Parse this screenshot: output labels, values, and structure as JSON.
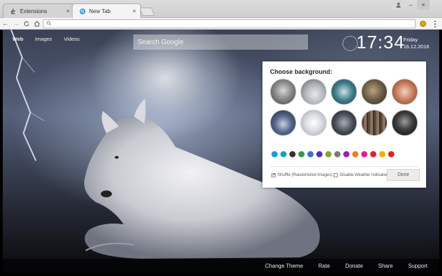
{
  "browser": {
    "tabs": [
      {
        "label": "Extensions",
        "icon": "puzzle-icon",
        "active": false
      },
      {
        "label": "New Tab",
        "icon": "new-tab-favicon",
        "active": true
      }
    ],
    "close_glyph": "×",
    "window_controls": {
      "user": "user-icon",
      "minimize": "–",
      "close": "×"
    },
    "nav": {
      "back": "←",
      "forward": "→",
      "reload": "C",
      "home": "⌂"
    },
    "omnibox": {
      "value": "",
      "icon": "search-icon"
    },
    "extension_icon": "extension-badge-icon",
    "menu_icon": "kebab-menu-icon"
  },
  "page": {
    "nav": [
      {
        "label": "Web",
        "active": true
      },
      {
        "label": "Images",
        "active": false
      },
      {
        "label": "Videos",
        "active": false
      }
    ],
    "search": {
      "placeholder": "Search Google"
    },
    "clock": {
      "time": "17:34",
      "day": "Friday",
      "date": "16.12.2016"
    }
  },
  "panel": {
    "title": "Choose background:",
    "thumbnails": [
      "wolf-face-gray",
      "wolf-lying-snow",
      "wolf-teal",
      "wolf-brown-forest",
      "wolf-red",
      "wolf-blue-night",
      "white-wolf-mist",
      "wolf-dark-moon",
      "forest-trees",
      "black-wolf"
    ],
    "colors": [
      "#1a9bd7",
      "#17a2b8",
      "#333333",
      "#2e9e44",
      "#3b6fd6",
      "#5a2db8",
      "#7bab2a",
      "#7a7a7a",
      "#9b1fb5",
      "#e8821e",
      "#e0218a",
      "#e02424",
      "#f0b400",
      "#d9261c"
    ],
    "options": [
      {
        "label": "Shuffle (Randomized Images)",
        "checked": true
      },
      {
        "label": "Disable Weather Indicator",
        "checked": false
      }
    ],
    "done_label": "Done"
  },
  "footer": {
    "links": [
      "Change Theme",
      "Rate",
      "Donate",
      "Share",
      "Support"
    ]
  }
}
